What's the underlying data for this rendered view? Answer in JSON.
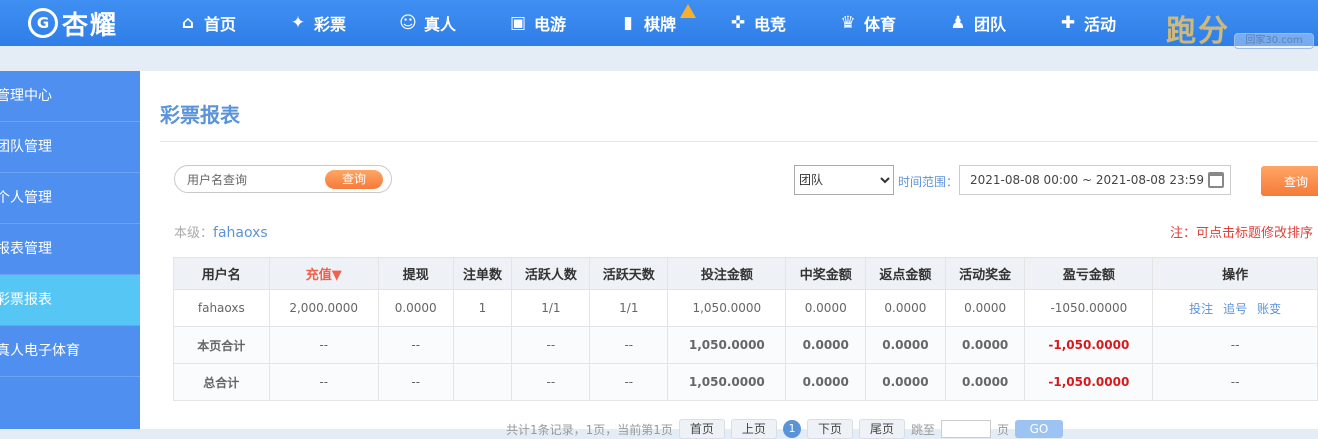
{
  "brand": {
    "logo_mark": "G",
    "name": "杏耀"
  },
  "nav": [
    {
      "label": "首页",
      "icon": "⌂",
      "icon_name": "home-icon"
    },
    {
      "label": "彩票",
      "icon": "✦",
      "icon_name": "lottery-icon"
    },
    {
      "label": "真人",
      "icon": "☺",
      "icon_name": "live-dealer-icon"
    },
    {
      "label": "电游",
      "icon": "▣",
      "icon_name": "slot-game-icon"
    },
    {
      "label": "棋牌",
      "icon": "▮",
      "icon_name": "card-game-icon",
      "hot": true
    },
    {
      "label": "电竞",
      "icon": "✜",
      "icon_name": "gamepad-icon"
    },
    {
      "label": "体育",
      "icon": "♛",
      "icon_name": "trophy-icon"
    },
    {
      "label": "团队",
      "icon": "♟",
      "icon_name": "team-icon"
    },
    {
      "label": "活动",
      "icon": "✚",
      "icon_name": "gift-icon"
    }
  ],
  "promo": {
    "text": "跑分",
    "watermark": "回家30.com"
  },
  "sidebar": {
    "items": [
      {
        "label": "管理中心"
      },
      {
        "label": "团队管理"
      },
      {
        "label": "个人管理"
      },
      {
        "label": "报表管理"
      },
      {
        "label": "彩票报表",
        "active": true
      },
      {
        "label": "真人电子体育"
      }
    ]
  },
  "page": {
    "title": "彩票报表",
    "search": {
      "placeholder": "用户名查询",
      "button": "查询"
    },
    "scope": {
      "selected": "团队"
    },
    "time_label": "时间范围：",
    "date_range": "2021-08-08 00:00 ~ 2021-08-08 23:59",
    "query_button": "查询",
    "level_label": "本级：",
    "level_user": "fahaoxs",
    "note": "注：可点击标题修改排序"
  },
  "table": {
    "headers": [
      "用户名",
      "充值▼",
      "提现",
      "注单数",
      "活跃人数",
      "活跃天数",
      "投注金额",
      "中奖金额",
      "返点金额",
      "活动奖金",
      "盈亏金额",
      "操作"
    ],
    "rows": [
      {
        "cells": [
          "fahaoxs",
          "2,000.0000",
          "0.0000",
          "1",
          "1/1",
          "1/1",
          "1,050.0000",
          "0.0000",
          "0.0000",
          "0.0000",
          "-1050.00000"
        ],
        "actions": [
          "投注",
          "追号",
          "账变"
        ]
      }
    ],
    "summaries": [
      {
        "cells": [
          "本页合计",
          "--",
          "--",
          "",
          "--",
          "--",
          "1,050.0000",
          "0.0000",
          "0.0000",
          "0.0000",
          "-1,050.0000",
          "--"
        ]
      },
      {
        "cells": [
          "总合计",
          "--",
          "--",
          "",
          "--",
          "--",
          "1,050.0000",
          "0.0000",
          "0.0000",
          "0.0000",
          "-1,050.0000",
          "--"
        ]
      }
    ]
  },
  "pager": {
    "prefix": "共计1条记录，1页，当前第1页",
    "first": "首页",
    "prev": "上页",
    "current": "1",
    "next": "下页",
    "last": "尾页",
    "goto_prefix": "跳至",
    "goto_suffix": "页",
    "go": "GO"
  }
}
